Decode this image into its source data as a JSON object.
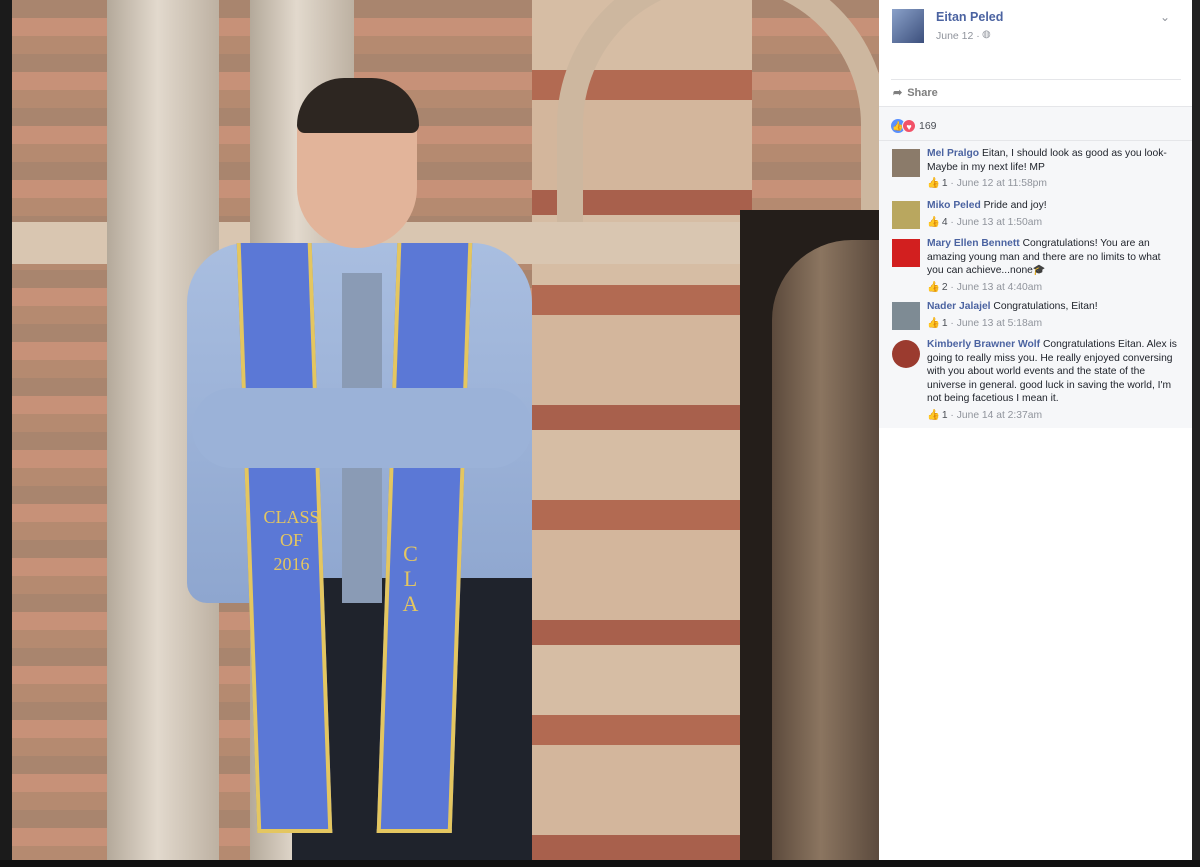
{
  "photo": {
    "stole_left_text": "CLASS\nOF\n2016",
    "stole_right_text": "CLA"
  },
  "post": {
    "author": "Eitan Peled",
    "date": "June 12 ·",
    "privacy_icon": "globe-icon",
    "options_icon": "chevron-down-icon",
    "share_label": "Share",
    "reaction_count": "169",
    "reaction_icons": [
      "like-icon",
      "love-icon"
    ]
  },
  "comments": [
    {
      "name": "Mel Pralgo",
      "text": "Eitan, I should look as good as you look-Maybe in my next life! MP",
      "likes": "1",
      "time": "June 12 at 11:58pm",
      "avatar_color": "#8b7b6a"
    },
    {
      "name": "Miko Peled",
      "text": "Pride and joy!",
      "likes": "4",
      "time": "June 13 at 1:50am",
      "avatar_color": "#b9a75f"
    },
    {
      "name": "Mary Ellen Bennett",
      "text": "Congratulations! You are an amazing young man and there are no limits to what you can achieve...none🎓",
      "likes": "2",
      "time": "June 13 at 4:40am",
      "avatar_color": "#d21f1f"
    },
    {
      "name": "Nader Jalajel",
      "text": "Congratulations, Eitan!",
      "likes": "1",
      "time": "June 13 at 5:18am",
      "avatar_color": "#7e8b94"
    },
    {
      "name": "Kimberly Brawner Wolf",
      "text": "Congratulations Eitan. Alex is going to really miss you. He really enjoyed conversing with you about world events and the state of the universe in general. good luck in saving the world, I'm not being facetious I mean it.",
      "likes": "1",
      "time": "June 14 at 2:37am",
      "avatar_color": "#9b3b2f"
    }
  ]
}
